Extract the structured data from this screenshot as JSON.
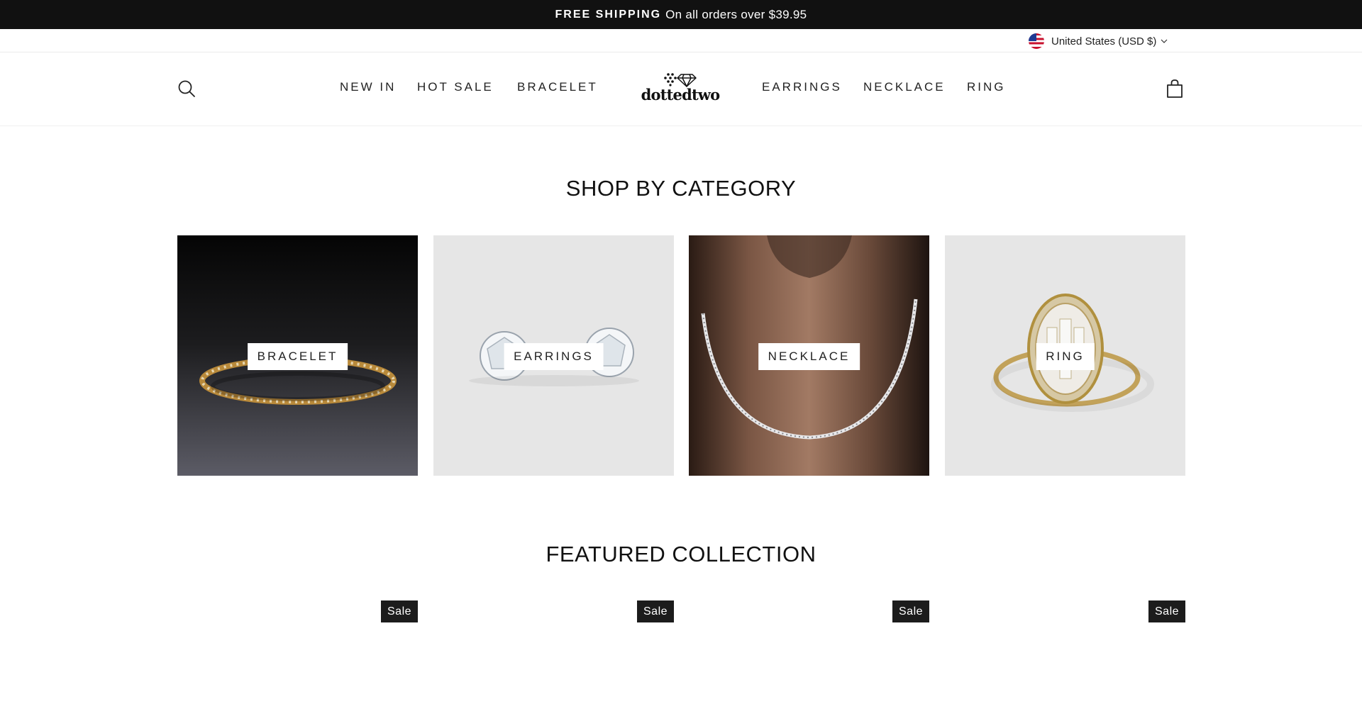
{
  "announcement": {
    "strong": "FREE SHIPPING",
    "text": "On all orders over $39.95"
  },
  "locale": {
    "label": "United States (USD $)",
    "flag_icon": "us-flag-icon",
    "dropdown_icon": "chevron-down-icon"
  },
  "header": {
    "search_icon": "search-icon",
    "cart_icon": "shopping-bag-icon",
    "logo_text": "dottedtwo",
    "nav_left": [
      {
        "label": "NEW IN"
      },
      {
        "label": "HOT SALE"
      },
      {
        "label": "BRACELET"
      }
    ],
    "nav_right": [
      {
        "label": "EARRINGS"
      },
      {
        "label": "NECKLACE"
      },
      {
        "label": "RING"
      }
    ]
  },
  "shop_by_category": {
    "title": "SHOP BY CATEGORY",
    "tiles": [
      {
        "label": "BRACELET"
      },
      {
        "label": "EARRINGS"
      },
      {
        "label": "NECKLACE"
      },
      {
        "label": "RING"
      }
    ]
  },
  "featured": {
    "title": "FEATURED COLLECTION",
    "badges": [
      "Sale",
      "Sale",
      "Sale",
      "Sale"
    ]
  },
  "colors": {
    "announcement_bg": "#111111",
    "badge_bg": "#1c1c1c",
    "tile_light_bg": "#e6e6e6"
  }
}
